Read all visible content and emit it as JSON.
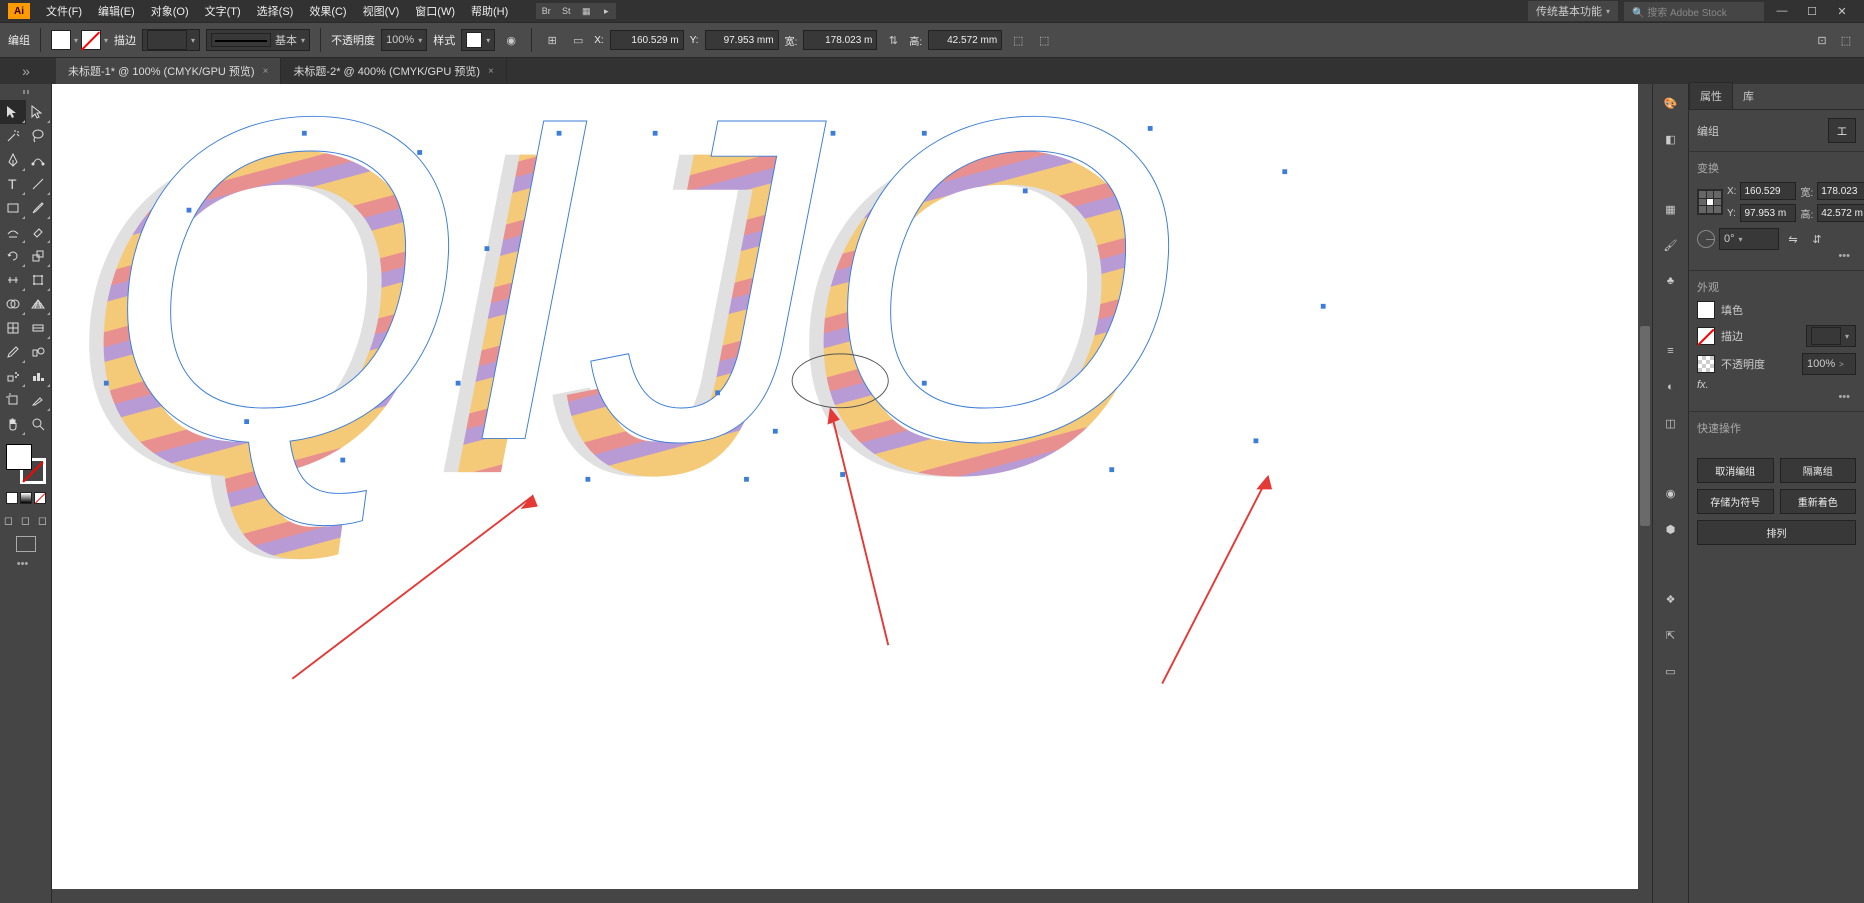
{
  "menubar": {
    "logo": "Ai",
    "items": [
      "文件(F)",
      "编辑(E)",
      "对象(O)",
      "文字(T)",
      "选择(S)",
      "效果(C)",
      "视图(V)",
      "窗口(W)",
      "帮助(H)"
    ],
    "badges": [
      "Br",
      "St"
    ],
    "workspace": "传统基本功能",
    "search_placeholder": "搜索 Adobe Stock"
  },
  "control": {
    "selection_label": "编组",
    "stroke_label": "描边",
    "stroke_weight": "",
    "stroke_profile": "基本",
    "opacity_label": "不透明度",
    "opacity": "100%",
    "style_label": "样式",
    "x_label": "X:",
    "x": "160.529 m",
    "y_label": "Y:",
    "y": "97.953 mm",
    "w_label": "宽:",
    "w": "178.023 m",
    "h_label": "高:",
    "h": "42.572 mm"
  },
  "tabs": [
    {
      "title": "未标题-1* @ 100% (CMYK/GPU 预览)",
      "active": false
    },
    {
      "title": "未标题-2* @ 400% (CMYK/GPU 预览)",
      "active": true
    }
  ],
  "props": {
    "tabs": [
      "属性",
      "库"
    ],
    "selection": "编组",
    "transform_btn": "工",
    "transform": {
      "title": "变换",
      "x_label": "X:",
      "x": "160.529",
      "y_label": "Y:",
      "y": "97.953 m",
      "w_label": "宽:",
      "w": "178.023",
      "h_label": "高:",
      "h": "42.572 m",
      "rotate_label": "⊿",
      "rotate": "0°"
    },
    "appearance": {
      "title": "外观",
      "fill_label": "填色",
      "stroke_label": "描边",
      "stroke_weight": "",
      "opacity_label": "不透明度",
      "opacity": "100%",
      "fx": "fx."
    },
    "quick": {
      "title": "快速操作",
      "cancel_group": "取消编组",
      "isolate_group": "隔离组",
      "save_symbol": "存储为符号",
      "recolor": "重新着色",
      "arrange": "排列"
    }
  },
  "more": "•••"
}
